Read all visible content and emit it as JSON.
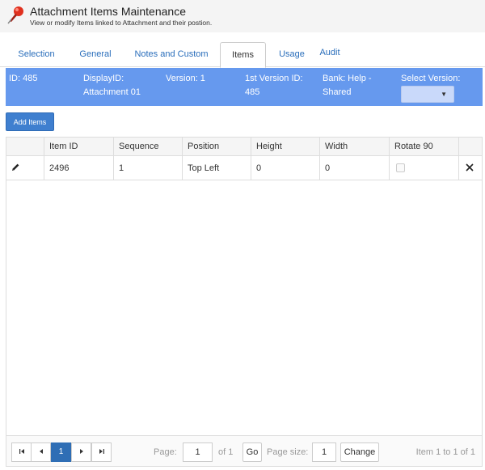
{
  "header": {
    "title": "Attachment Items Maintenance",
    "subtitle": "View or modify Items linked to Attachment and their postion.",
    "icon": "pushpin-icon"
  },
  "tabs": [
    {
      "label": "Selection",
      "active": false
    },
    {
      "label": "General",
      "active": false
    },
    {
      "label": "Notes and Custom",
      "active": false
    },
    {
      "label": "Items",
      "active": true
    },
    {
      "label": "Usage",
      "active": false
    },
    {
      "label": "Audit",
      "active": false
    }
  ],
  "info": {
    "id": "ID: 485",
    "display_id_label": "DisplayID:",
    "display_id_value": "Attachment 01",
    "version": "Version: 1",
    "first_version_label": "1st Version ID:",
    "first_version_value": "485",
    "bank_label": "Bank: Help -",
    "bank_value": "Shared",
    "select_version_label": "Select Version:",
    "select_version_value": ""
  },
  "toolbar": {
    "add_label": "Add Items"
  },
  "table": {
    "columns": [
      "",
      "Item ID",
      "Sequence",
      "Position",
      "Height",
      "Width",
      "Rotate 90",
      ""
    ],
    "rows": [
      {
        "item_id": "2496",
        "sequence": "1",
        "position": "Top Left",
        "height": "0",
        "width": "0",
        "rotate90": false
      }
    ]
  },
  "pager": {
    "current_page": "1",
    "page_label": "Page:",
    "page_value": "1",
    "of_label": "of 1",
    "go_label": "Go",
    "page_size_label": "Page size:",
    "page_size_value": "1",
    "change_label": "Change",
    "summary": "Item 1 to 1 of 1"
  },
  "colors": {
    "accent": "#6699ee",
    "button": "#3f7fcf",
    "link": "#2a6ebb"
  }
}
